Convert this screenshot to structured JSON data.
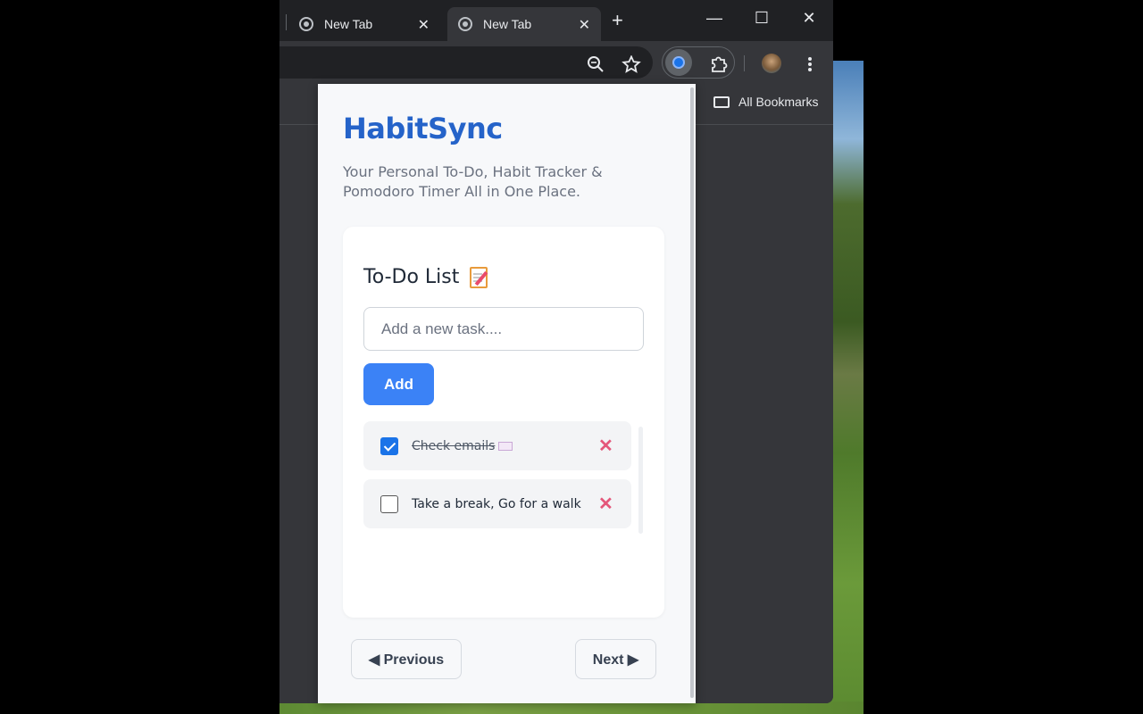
{
  "browser": {
    "tabs": [
      {
        "title": "New Tab",
        "close": "✕"
      },
      {
        "title": "New Tab",
        "close": "✕"
      }
    ],
    "new_tab": "+",
    "window_controls": {
      "minimize": "—",
      "maximize": "☐",
      "close": "✕"
    },
    "toolbar_icons": [
      "zoom-icon",
      "star-icon",
      "extension-active-icon",
      "puzzle-icon",
      "avatar",
      "menu-icon"
    ],
    "bookmarks": {
      "all_bookmarks_label": "All Bookmarks"
    }
  },
  "app": {
    "brand": "HabitSync",
    "tagline": "Your Personal To-Do, Habit Tracker & Pomodoro Timer All in One Place.",
    "todo": {
      "title": "To-Do List",
      "input_placeholder": "Add a new task....",
      "add_label": "Add",
      "tasks": [
        {
          "text": "Check emails",
          "done": true
        },
        {
          "text": "Take a break, Go for a walk",
          "done": false
        }
      ]
    },
    "nav": {
      "previous_label": "◀ Previous",
      "next_label": "Next ▶"
    }
  },
  "colors": {
    "brand": "#2563c9",
    "accent": "#3b82f6",
    "delete": "#e4577a",
    "checkbox": "#1a73e8"
  }
}
